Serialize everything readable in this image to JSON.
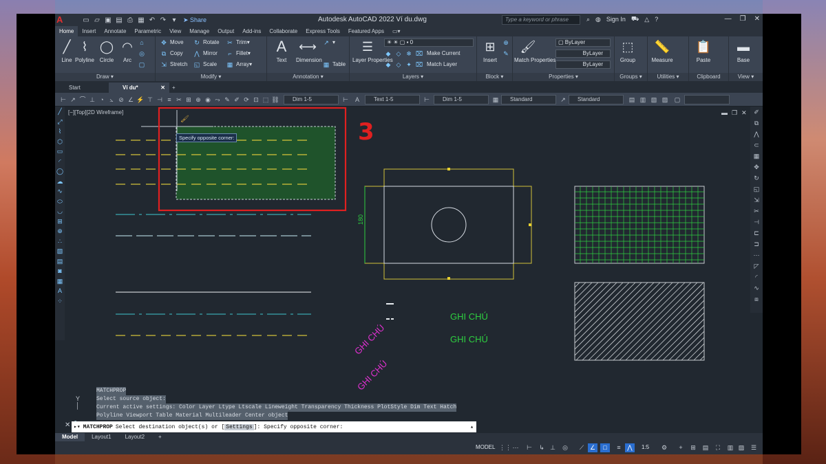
{
  "app": {
    "title": "Autodesk AutoCAD 2022   Ví du.dwg",
    "logo_glyph": "A",
    "share_label": "Share",
    "search_placeholder": "Type a keyword or phrase",
    "sign_in": "Sign In"
  },
  "ribbon_tabs": [
    "Home",
    "Insert",
    "Annotate",
    "Parametric",
    "View",
    "Manage",
    "Output",
    "Add-ins",
    "Collaborate",
    "Express Tools",
    "Featured Apps"
  ],
  "ribbon": {
    "draw": {
      "title": "Draw",
      "line": "Line",
      "polyline": "Polyline",
      "circle": "Circle",
      "arc": "Arc"
    },
    "modify": {
      "title": "Modify",
      "move": "Move",
      "rotate": "Rotate",
      "trim": "Trim",
      "copy": "Copy",
      "mirror": "Mirror",
      "fillet": "Fillet",
      "stretch": "Stretch",
      "scale": "Scale",
      "array": "Array"
    },
    "annotation": {
      "title": "Annotation",
      "text": "Text",
      "dimension": "Dimension",
      "table": "Table"
    },
    "layers": {
      "title": "Layers",
      "layer_properties": "Layer Properties",
      "current_layer": "0",
      "make_current": "Make Current",
      "match_layer": "Match Layer"
    },
    "block": {
      "title": "Block",
      "insert": "Insert"
    },
    "properties": {
      "title": "Properties",
      "match_properties": "Match Properties",
      "color": "ByLayer",
      "linetype": "ByLayer",
      "lineweight": "ByLayer"
    },
    "groups": {
      "title": "Groups",
      "group": "Group"
    },
    "utilities": {
      "title": "Utilities",
      "measure": "Measure"
    },
    "clipboard": {
      "title": "Clipboard",
      "paste": "Paste"
    },
    "view": {
      "title": "View",
      "base": "Base"
    }
  },
  "doc_tabs": {
    "start": "Start",
    "active": "Ví du*",
    "close": "✕",
    "add": "+"
  },
  "prop_toolbar": {
    "dim_style_1": "Dim 1-5",
    "text_style": "Text 1-5",
    "dim_style_2": "Dim 1-5",
    "table_style": "Standard",
    "mleader_style": "Standard"
  },
  "viewport": {
    "label": "[−][Top][2D Wireframe]",
    "tooltip": "Specify opposite corner:",
    "step_number": "3",
    "dim_text": "180"
  },
  "notes": [
    "GHI CHÚ",
    "GHI CHÚ",
    "GHI CHÚ",
    "GHI CHÚ"
  ],
  "command": {
    "history": [
      "MATCHPROP",
      "Select source object:",
      "Current active settings:  Color Layer Ltype Ltscale Lineweight Transparency Thickness PlotStyle Dim Text Hatch",
      "Polyline Viewport Table Material Multileader Center object"
    ],
    "name": "MATCHPROP",
    "prompt_pre": "Select destination object(s) or [",
    "prompt_opt": "Settings",
    "prompt_post": "]: Specify opposite corner:"
  },
  "layout_tabs": {
    "model": "Model",
    "layout1": "Layout1",
    "layout2": "Layout2",
    "add": "+"
  },
  "status": {
    "model": "MODEL",
    "scale": "1:5"
  },
  "colors": {
    "accent": "#2a6ed0",
    "highlight_box": "#e02020",
    "selection_fill": "#1f5a2a",
    "yellow": "#d4c23a",
    "cyan": "#3aa8b0",
    "green_text": "#2ed040",
    "magenta": "#e030d0"
  }
}
